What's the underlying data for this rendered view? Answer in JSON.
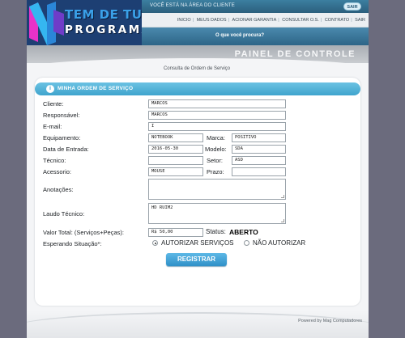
{
  "header": {
    "welcome": "VOCÊ ESTÁ NA ÁREA DO CLIENTE",
    "logout_button": "SAIR",
    "logo_line1": "TEM DE TUDO",
    "logo_line2": "PROGRAMAS",
    "nav": [
      "INICIO",
      "MEUS DADOS",
      "ACIONAR GARANTIA",
      "CONSULTAR O.S.",
      "CONTRATO",
      "SAIR"
    ],
    "search_prompt": "O que você procura?"
  },
  "banner": {
    "title": "PAINEL DE CONTROLE"
  },
  "page": {
    "subtitle": "Consulta de Ordem de Serviço"
  },
  "card": {
    "title": "MINHA ORDEM DE SERVIÇO",
    "title_icon": "info-icon"
  },
  "form": {
    "cliente": {
      "label": "Cliente:",
      "value": "MARCOS"
    },
    "responsavel": {
      "label": "Responsável:",
      "value": "MARCOS"
    },
    "email": {
      "label": "E-mail:",
      "value": "I"
    },
    "equipamento": {
      "label": "Equipamento:",
      "value": "NOTEBOOK"
    },
    "marca": {
      "label": "Marca:",
      "value": "POSITIVO"
    },
    "data_entrada": {
      "label": "Data de Entrada:",
      "value": "2016-05-30"
    },
    "modelo": {
      "label": "Modelo:",
      "value": "SDA"
    },
    "tecnico": {
      "label": "Técnico:",
      "value": ""
    },
    "setor": {
      "label": "Setor:",
      "value": "ASD"
    },
    "acessorio": {
      "label": "Acessorio:",
      "value": "MOUSE"
    },
    "prazo": {
      "label": "Prazo:",
      "value": ""
    },
    "anotacoes": {
      "label": "Anotações:",
      "value": ""
    },
    "laudo": {
      "label": "Laudo Técnico:",
      "value": "HD RUIM2"
    },
    "valor_total": {
      "label": "Valor Total: (Serviços+Peças):",
      "value": "R$ 50,00"
    },
    "status": {
      "label": "Status:",
      "value": "ABERTO"
    },
    "esperando": {
      "label": "Esperando Situação*:",
      "options": [
        "AUTORIZAR SERVIÇOS",
        "NÃO AUTORIZAR"
      ],
      "selected": "AUTORIZAR SERVIÇOS"
    },
    "submit_label": "REGISTRAR"
  },
  "footer": {
    "text": "Powered by Mag Computadores"
  },
  "colors": {
    "accent": "#3fa4cd",
    "header": "#2c5f7d",
    "button": "#2f90c8"
  }
}
